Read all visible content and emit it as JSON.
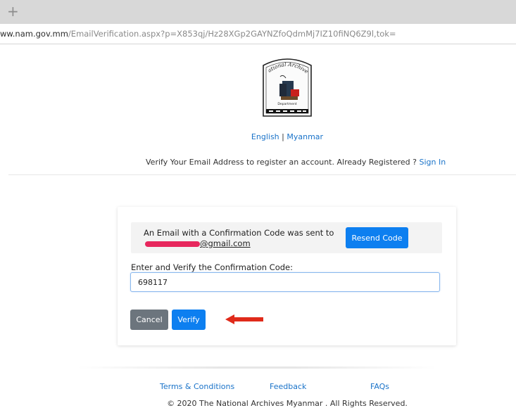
{
  "browser": {
    "new_tab_icon": "+",
    "url_host": "ww.nam.gov.mm",
    "url_path": "/EmailVerification.aspx?p=X853qj/Hz28XGp2GAYNZfoQdmMj7IZ10fiNQ6Z9l,tok="
  },
  "header": {
    "logo_text_top": "National Archives",
    "logo_text_bottom": "Department",
    "lang_english": "English",
    "lang_separator": "|",
    "lang_myanmar": "Myanmar",
    "verify_prompt": "Verify Your Email Address to register an account. Already Registered ?",
    "sign_in": "Sign In"
  },
  "card": {
    "notice_line1": "An Email with a Confirmation Code was sent to",
    "email_domain": "@gmail.com",
    "resend_label": "Resend Code",
    "code_label": "Enter and Verify the Confirmation Code:",
    "code_value": "698117",
    "cancel_label": "Cancel",
    "verify_label": "Verify"
  },
  "footer": {
    "terms": "Terms & Conditions",
    "feedback": "Feedback",
    "faqs": "FAQs",
    "copyright": "© 2020 The National Archives Myanmar . All Rights Reserved."
  },
  "colors": {
    "primary": "#0d7ff0",
    "secondary": "#6c757d",
    "link": "#1a73c9",
    "redaction": "#e7275d",
    "arrow": "#e02a1a"
  },
  "icons": {
    "new_tab": "plus-icon",
    "arrow": "red-arrow-left-icon",
    "logo": "national-archives-logo"
  }
}
